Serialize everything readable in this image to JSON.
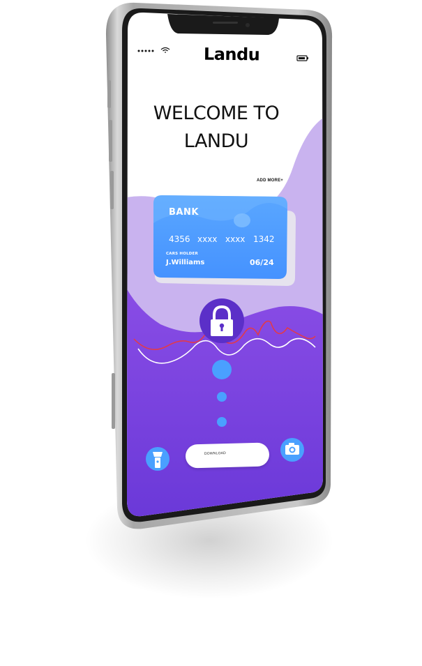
{
  "app": {
    "title": "Landu"
  },
  "status_bar": {
    "signal_icon": "signal-dots-icon",
    "wifi_icon": "wifi-icon",
    "battery_icon": "battery-icon"
  },
  "welcome": {
    "line1": "WELCOME TO",
    "line2": "LANDU"
  },
  "add_more_label": "ADD MORE+",
  "card": {
    "bank_label": "BANK",
    "number_groups": [
      "4356",
      "xxxx",
      "xxxx",
      "1342"
    ],
    "holder_label": "CARS HOLDER",
    "holder_name": "J.Williams",
    "expiry": "06/24"
  },
  "actions": {
    "lock_icon": "padlock-icon",
    "flashlight_icon": "flashlight-icon",
    "camera_icon": "camera-icon",
    "download_label": "DOWNLOAD"
  },
  "colors": {
    "purple_dark": "#6c3ddc",
    "purple_mid": "#7c45e0",
    "lavender": "#c9b3ef",
    "card_blue": "#4b9bff",
    "accent_blue": "#4aa0ff",
    "wave_red": "#e23a4a"
  }
}
